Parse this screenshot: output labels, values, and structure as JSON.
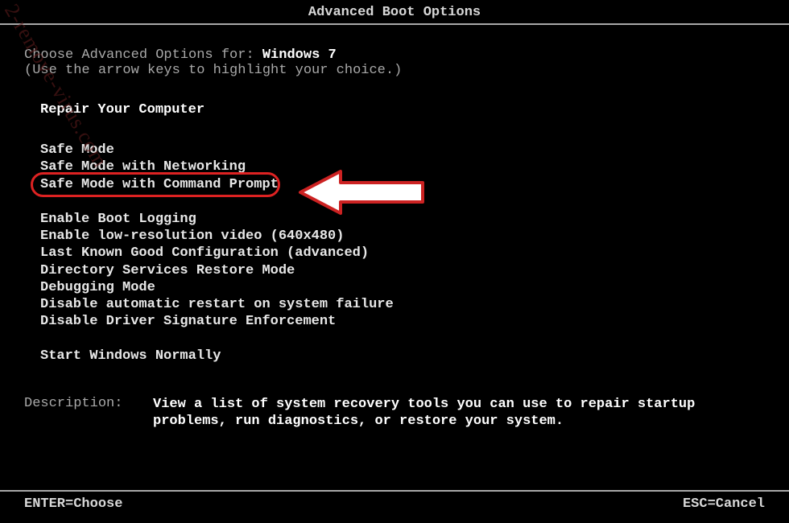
{
  "title": "Advanced Boot Options",
  "choose_prefix": "Choose Advanced Options for: ",
  "os_name": "Windows 7",
  "hint": "(Use the arrow keys to highlight your choice.)",
  "selected_section": "Repair Your Computer",
  "group1": {
    "items": [
      "Safe Mode",
      "Safe Mode with Networking",
      "Safe Mode with Command Prompt"
    ]
  },
  "group2": {
    "items": [
      "Enable Boot Logging",
      "Enable low-resolution video (640x480)",
      "Last Known Good Configuration (advanced)",
      "Directory Services Restore Mode",
      "Debugging Mode",
      "Disable automatic restart on system failure",
      "Disable Driver Signature Enforcement"
    ]
  },
  "start_normal": "Start Windows Normally",
  "description": {
    "label": "Description:",
    "text": "View a list of system recovery tools you can use to repair startup problems, run diagnostics, or restore your system."
  },
  "footer": {
    "enter": "ENTER=Choose",
    "esc": "ESC=Cancel"
  },
  "watermark": "2-remove-virus.com",
  "highlight_color": "#dd2222"
}
